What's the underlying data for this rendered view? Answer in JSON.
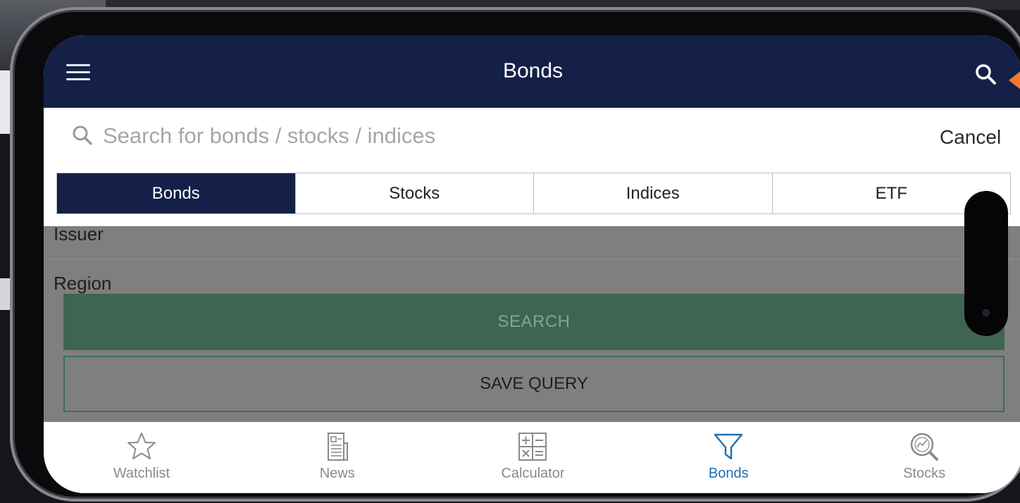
{
  "topbar": {
    "title": "Bonds",
    "menu_icon": "hamburger-menu-icon",
    "search_icon": "search-icon"
  },
  "search": {
    "placeholder": "Search for bonds / stocks / indices",
    "value": "",
    "cancel_label": "Cancel"
  },
  "tabs": [
    {
      "label": "Bonds",
      "active": true
    },
    {
      "label": "Stocks",
      "active": false
    },
    {
      "label": "Indices",
      "active": false
    },
    {
      "label": "ETF",
      "active": false
    }
  ],
  "filters": {
    "issuer_label": "Issuer",
    "region_label": "Region"
  },
  "actions": {
    "search_label": "SEARCH",
    "save_query_label": "SAVE QUERY"
  },
  "bottom_nav": [
    {
      "label": "Watchlist",
      "icon": "star-icon",
      "active": false
    },
    {
      "label": "News",
      "icon": "newspaper-icon",
      "active": false
    },
    {
      "label": "Calculator",
      "icon": "calculator-icon",
      "active": false
    },
    {
      "label": "Bonds",
      "icon": "filter-funnel-icon",
      "active": true
    },
    {
      "label": "Stocks",
      "icon": "stock-search-icon",
      "active": false
    }
  ],
  "colors": {
    "header": "#152048",
    "active_nav": "#1d6fb1",
    "search_button": "#3e6553",
    "accent_arrow": "#f07a2e"
  }
}
